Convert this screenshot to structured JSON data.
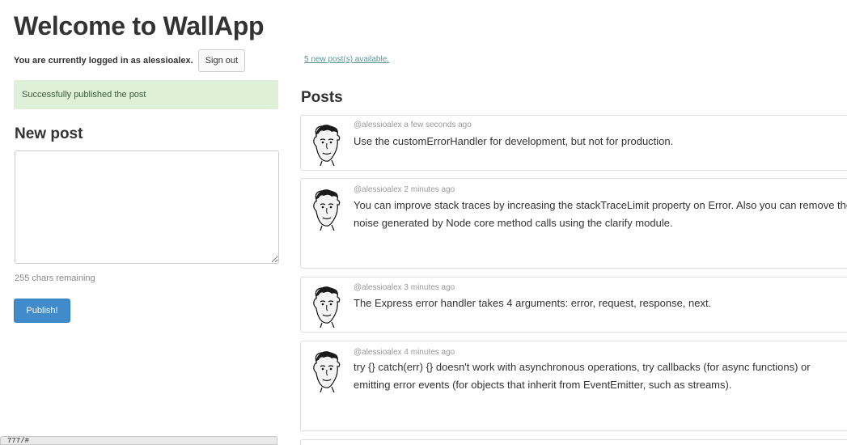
{
  "header": {
    "title": "Welcome to WallApp",
    "login_text": "You are currently logged in as alessioalex.",
    "sign_out_label": "Sign out",
    "new_posts_link": "5 new post(s) available."
  },
  "compose": {
    "alert": "Successfully published the post",
    "heading": "New post",
    "textarea_value": "",
    "chars_remaining": "255 chars remaining",
    "publish_label": "Publish!"
  },
  "feed": {
    "heading": "Posts",
    "posts": [
      {
        "meta": "@alessioalex a few seconds ago",
        "body": "Use the customErrorHandler for development, but not for production.",
        "avatar_icon": "user-avatar-icon"
      },
      {
        "meta": "@alessioalex 2 minutes ago",
        "body": "You can improve stack traces by increasing the stackTraceLimit property on Error. Also you can remove the noise generated by Node core method calls using the clarify module.",
        "avatar_icon": "user-avatar-icon"
      },
      {
        "meta": "@alessioalex 3 minutes ago",
        "body": "The Express error handler takes 4 arguments: error, request, response, next.",
        "avatar_icon": "user-avatar-icon"
      },
      {
        "meta": "@alessioalex 4 minutes ago",
        "body": "try {} catch(err) {} doesn't work with asynchronous operations, try callbacks (for async functions) or emitting error events (for objects that inherit from EventEmitter, such as streams).",
        "avatar_icon": "user-avatar-icon"
      }
    ]
  },
  "status_bar": {
    "text": "777/#"
  },
  "colors": {
    "accent": "#428bca",
    "success_bg": "#dff0d8",
    "link": "#5a9595"
  }
}
